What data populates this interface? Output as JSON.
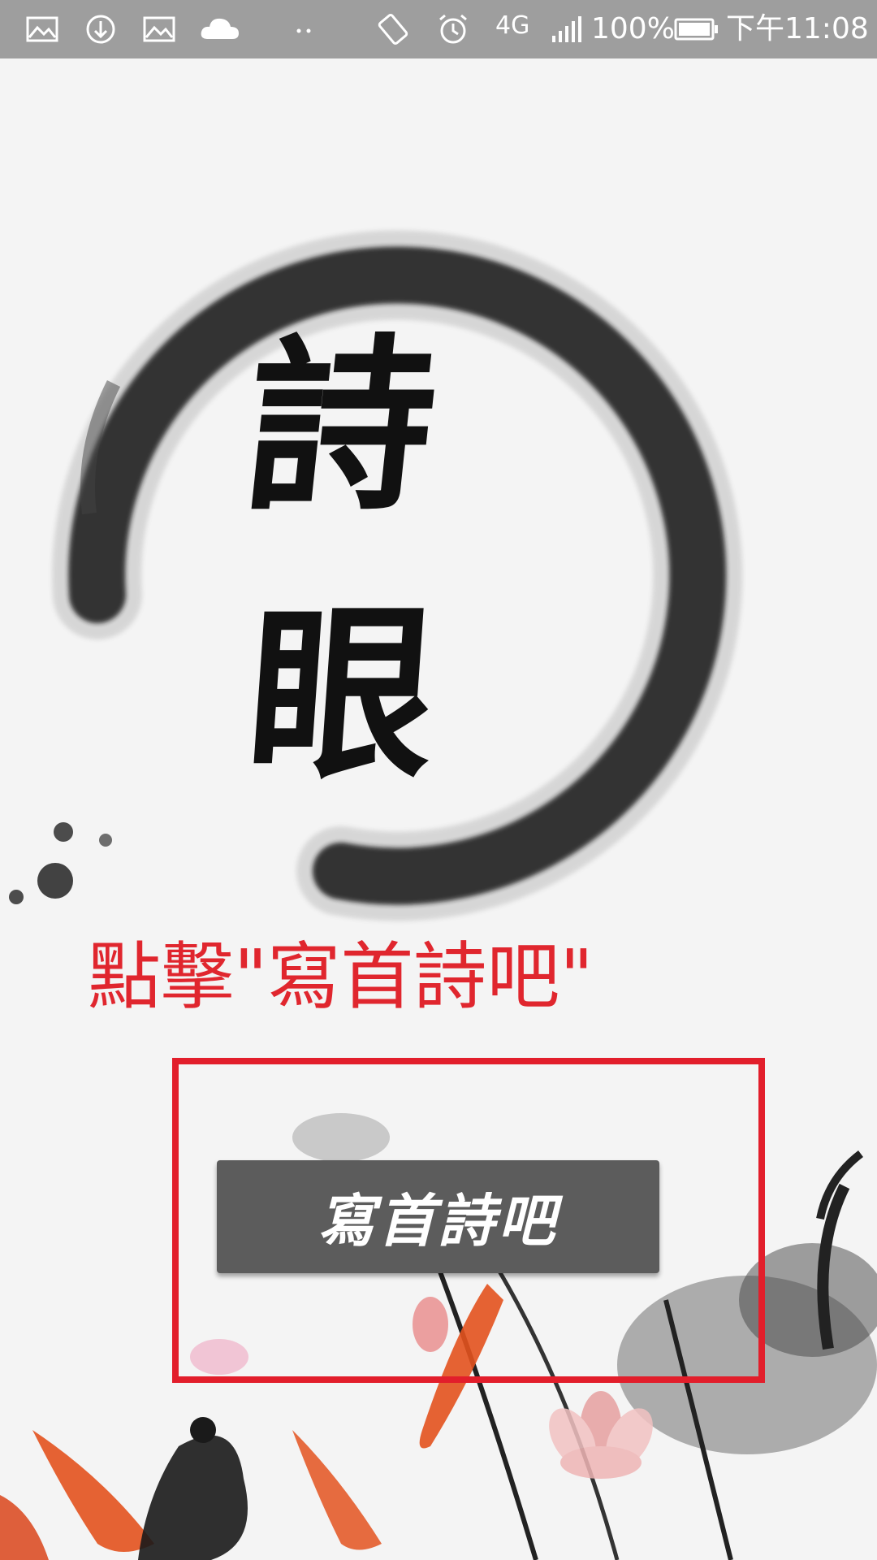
{
  "status_bar": {
    "network": "4G",
    "battery": "100%",
    "time": "下午11:08",
    "icons": [
      "image-icon",
      "download-sync-icon",
      "image-icon",
      "cloud-icon",
      "more-dots-icon",
      "auto-rotate-icon",
      "alarm-icon",
      "signal-icon",
      "battery-icon"
    ]
  },
  "app": {
    "logo_char_1": "詩",
    "logo_char_2": "眼",
    "instruction": "點擊\"寫首詩吧\"",
    "button_label": "寫首詩吧"
  },
  "colors": {
    "status_bar": "#9e9e9e",
    "instruction_red": "#e0262e",
    "highlight_red": "#e21e2b",
    "button": "#5c5c5c",
    "background": "#f4f4f4"
  }
}
